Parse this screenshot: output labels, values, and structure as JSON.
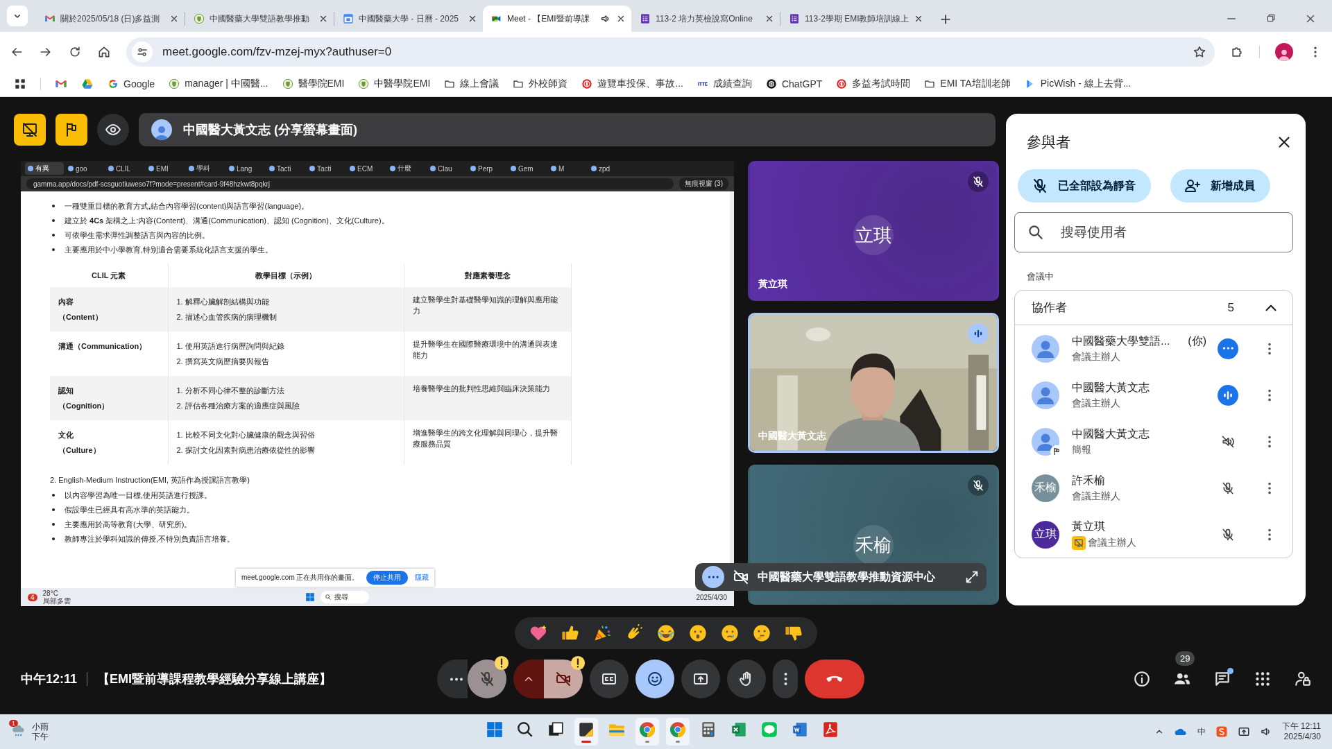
{
  "browser": {
    "tabs": [
      {
        "title": "關於2025/05/18 (日)多益測",
        "kind": "gmail",
        "selected": false,
        "audio": false
      },
      {
        "title": "中國醫藥大學雙語教學推動",
        "kind": "cmu",
        "selected": false,
        "audio": false
      },
      {
        "title": "中國醫藥大學 - 日曆 - 2025",
        "kind": "calendar",
        "selected": false,
        "audio": false
      },
      {
        "title": "Meet - 【EMI暨前導課",
        "kind": "meet",
        "selected": true,
        "audio": true
      },
      {
        "title": "113-2 培力英檢說寫Online",
        "kind": "forms",
        "selected": false,
        "audio": false
      },
      {
        "title": "113-2學期 EMI教師培訓線上",
        "kind": "forms",
        "selected": false,
        "audio": false
      }
    ],
    "url": "meet.google.com/fzv-mzej-myx?authuser=0",
    "bookmarks": [
      {
        "kind": "gmail"
      },
      {
        "kind": "drive"
      },
      {
        "kind": "google",
        "label": "Google"
      },
      {
        "kind": "cmu",
        "label": "manager | 中國醫..."
      },
      {
        "kind": "cmu",
        "label": "醫學院EMI"
      },
      {
        "kind": "cmu",
        "label": "中醫學院EMI"
      },
      {
        "kind": "folder",
        "label": "線上會議"
      },
      {
        "kind": "folder",
        "label": "外校師資"
      },
      {
        "kind": "seal",
        "label": "遊覽車投保、事故..."
      },
      {
        "kind": "ittc",
        "label": "成績查詢"
      },
      {
        "kind": "chatgpt",
        "label": "ChatGPT"
      },
      {
        "kind": "seal",
        "label": "多益考試時間"
      },
      {
        "kind": "folder",
        "label": "EMI TA培訓老師"
      },
      {
        "kind": "picwish",
        "label": "PicWish - 線上去背..."
      }
    ]
  },
  "meet": {
    "presenter_bar": {
      "label": "中國醫大黃文志 (分享螢幕畫面)"
    },
    "shared_screen": {
      "tabs": [
        {
          "label": "有異",
          "selected": true
        },
        {
          "label": "goo",
          "selected": false
        },
        {
          "label": "CLIL",
          "selected": false
        },
        {
          "label": "EMI",
          "selected": false
        },
        {
          "label": "學科",
          "selected": false
        },
        {
          "label": "Lang",
          "selected": false
        },
        {
          "label": "Tacti",
          "selected": false
        },
        {
          "label": "Tacti",
          "selected": false
        },
        {
          "label": "ECM",
          "selected": false
        },
        {
          "label": "什麼",
          "selected": false
        },
        {
          "label": "Clau",
          "selected": false
        },
        {
          "label": "Perp",
          "selected": false
        },
        {
          "label": "Gem",
          "selected": false
        },
        {
          "label": "M",
          "selected": false
        },
        {
          "label": "zpd",
          "selected": false
        }
      ],
      "url": "gamma.app/docs/pdf-scsguotiuweso7f?mode=present#card-9f48hzkwt8pqkrj",
      "incognito": "無痕視窗 (3)",
      "bullets": [
        "一種雙重目標的教育方式,結合內容學習(content)與語言學習(language)。",
        "建立於 **4Cs** 架構之上:內容(Content)、溝通(Communication)、認知 (Cognition)、文化(Culture)。",
        "可依學生需求彈性調整語言與內容的比例。",
        "主要應用於中小學教育,特別適合需要系統化語言支援的學生。"
      ],
      "table": {
        "columns": [
          "CLIL 元素",
          "教學目標（示例）",
          "對應素養理念"
        ],
        "rows": [
          {
            "element": [
              "內容",
              "（Content）"
            ],
            "goals": [
              "1. 解釋心臟解剖結構與功能",
              "2. 描述心血管疾病的病理機制"
            ],
            "concept": "建立醫學生對基礎醫學知識的理解與應用能力"
          },
          {
            "element": [
              "溝通（Communication）"
            ],
            "goals": [
              "1. 使用英語進行病歷詢問與紀錄",
              "2. 撰寫英文病歷摘要與報告"
            ],
            "concept": "提升醫學生在國際醫療環境中的溝通與表達能力"
          },
          {
            "element": [
              "認知",
              "（Cognition）"
            ],
            "goals": [
              "1. 分析不同心律不整的診斷方法",
              "2. 評估各種治療方案的適應症與風險"
            ],
            "concept": "培養醫學生的批判性思維與臨床決策能力"
          },
          {
            "element": [
              "文化",
              "（Culture）"
            ],
            "goals": [
              "1. 比較不同文化對心臟健康的觀念與習俗",
              "2. 探討文化因素對病患治療依從性的影響"
            ],
            "concept": "增進醫學生的跨文化理解與同理心，提升醫療服務品質"
          }
        ]
      },
      "section_2": "2. English-Medium Instruction(EMI, 英語作為授課語言教學)",
      "bullets_2": [
        "以內容學習為唯一目標,使用英語進行授課。",
        "假設學生已經具有高水準的英語能力。",
        "主要應用於高等教育(大學、研究所)。",
        "教師專注於學科知識的傳授,不特別負責語言培養。"
      ],
      "share_notice": {
        "text": "meet.google.com 正在共用你的畫面。",
        "stop": "停止共用",
        "hide": "隱藏"
      },
      "taskbar": {
        "badge": "4",
        "temp": "28°C",
        "weather": "局部多雲",
        "search": "搜尋",
        "date": "2025/4/30"
      }
    },
    "tiles": [
      {
        "kind": "avatar",
        "initials": "立琪",
        "name": "黃立琪",
        "muted": true,
        "speaking": false,
        "color": "#5b30a6"
      },
      {
        "kind": "video",
        "name": "中國醫大黃文志",
        "muted": false,
        "speaking": true,
        "color": "#b9b49c"
      },
      {
        "kind": "avatar",
        "initials": "禾榆",
        "muted": true,
        "speaking": false,
        "color": "#426b78"
      }
    ],
    "presenter_overlay": {
      "label": "中國醫藥大學雙語教學推動資源中心"
    },
    "participants": {
      "title": "參與者",
      "mute_all": "已全部設為靜音",
      "add": "新增成員",
      "search": {
        "placeholder": "搜尋使用者"
      },
      "section": "會議中",
      "group": {
        "label": "協作者",
        "count": "5",
        "expanded": true,
        "people": [
          {
            "name": "中國醫藥大學雙語...",
            "you": "(你)",
            "role": "會議主辦人",
            "kind": "more",
            "pinned": false,
            "badge": false
          },
          {
            "name": "中國醫大黃文志",
            "role": "會議主辦人",
            "kind": "speaking",
            "pinned": false,
            "badge": false
          },
          {
            "name": "中國醫大黃文志",
            "role": "簡報",
            "kind": "audio-off",
            "pinned": true,
            "badge": false
          },
          {
            "name": "許禾榆",
            "role": "會議主辦人",
            "initials": "禾榆",
            "color": "#78909c",
            "kind": "muted",
            "pinned": false,
            "badge": false
          },
          {
            "name": "黃立琪",
            "role": "會議主辦人",
            "initials": "立琪",
            "color": "#4c2a9c",
            "kind": "muted",
            "pinned": false,
            "badge": true
          }
        ]
      }
    },
    "reactions": [
      {
        "kind": "heart"
      },
      {
        "kind": "thumbs-up"
      },
      {
        "kind": "party"
      },
      {
        "kind": "clap"
      },
      {
        "kind": "laugh"
      },
      {
        "kind": "surprised"
      },
      {
        "kind": "cry"
      },
      {
        "kind": "thinking"
      },
      {
        "kind": "thumbs-down"
      }
    ],
    "meeting_time": "中午12:11",
    "meeting_title": "【EMI暨前導課程教學經驗分享線上講座】",
    "controls": [
      {
        "kind": "more",
        "on": false,
        "warning": false
      },
      {
        "kind": "mic",
        "on": false,
        "warning": true
      },
      {
        "kind": "camera",
        "on": false,
        "warning": true
      },
      {
        "kind": "captions",
        "on": false,
        "warning": false
      },
      {
        "kind": "reactions",
        "on": true,
        "warning": false
      },
      {
        "kind": "present",
        "on": false,
        "warning": false
      },
      {
        "kind": "hand",
        "on": false,
        "warning": false
      },
      {
        "kind": "options",
        "on": false,
        "warning": false
      },
      {
        "kind": "leave",
        "on": false,
        "warning": false
      }
    ],
    "side_controls": [
      {
        "kind": "info",
        "dot": false
      },
      {
        "kind": "people",
        "badge": "29",
        "dot": false
      },
      {
        "kind": "chat",
        "dot": true
      },
      {
        "kind": "apps",
        "dot": false
      },
      {
        "kind": "host",
        "dot": false
      }
    ]
  },
  "taskbar": {
    "weather": {
      "badge": "1",
      "label": "小雨",
      "sub": "下午"
    },
    "apps": [
      {
        "kind": "start",
        "active": false
      },
      {
        "kind": "search",
        "active": false
      },
      {
        "kind": "taskview",
        "active": false
      },
      {
        "kind": "sticky",
        "active": true
      },
      {
        "kind": "explorer",
        "active": false
      },
      {
        "kind": "chrome",
        "active": true
      },
      {
        "kind": "chrome",
        "active": true
      },
      {
        "kind": "calculator",
        "active": false
      },
      {
        "kind": "excel",
        "active": false
      },
      {
        "kind": "line",
        "active": false
      },
      {
        "kind": "word",
        "active": false
      },
      {
        "kind": "acrobat",
        "active": false
      }
    ],
    "ime": "中",
    "time": "下午 12:11",
    "date": "2025/4/30"
  }
}
